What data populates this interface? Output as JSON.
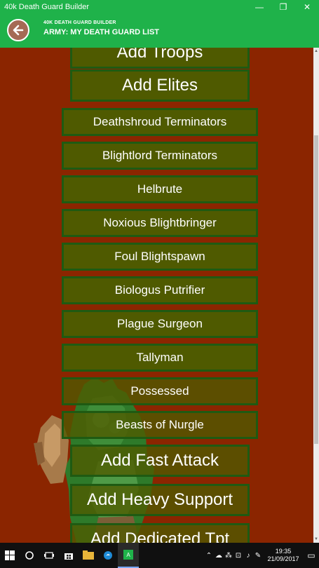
{
  "window": {
    "title": "40k Death Guard Builder",
    "minimize": "—",
    "maximize": "❐",
    "close": "✕"
  },
  "header": {
    "app_name": "40K DEATH GUARD BUILDER",
    "army_title": "ARMY: MY DEATH GUARD LIST"
  },
  "content": {
    "add_troops": "Add Troops",
    "add_elites": "Add Elites",
    "units": [
      "Deathshroud Terminators",
      "Blightlord Terminators",
      "Helbrute",
      "Noxious Blightbringer",
      "Foul Blightspawn",
      "Biologus Putrifier",
      "Plague Surgeon",
      "Tallyman",
      "Possessed",
      "Beasts of Nurgle"
    ],
    "add_fast_attack": "Add Fast Attack",
    "add_heavy_support": "Add Heavy Support",
    "add_dedicated_transport": "Add Dedicated Tpt"
  },
  "taskbar": {
    "time": "19:35",
    "date": "21/09/2017",
    "active_app_letter": "A"
  },
  "colors": {
    "accent": "#1fb24a",
    "background": "#8b2500",
    "button": "#4f5a00",
    "button_border": "#1f5a12"
  }
}
